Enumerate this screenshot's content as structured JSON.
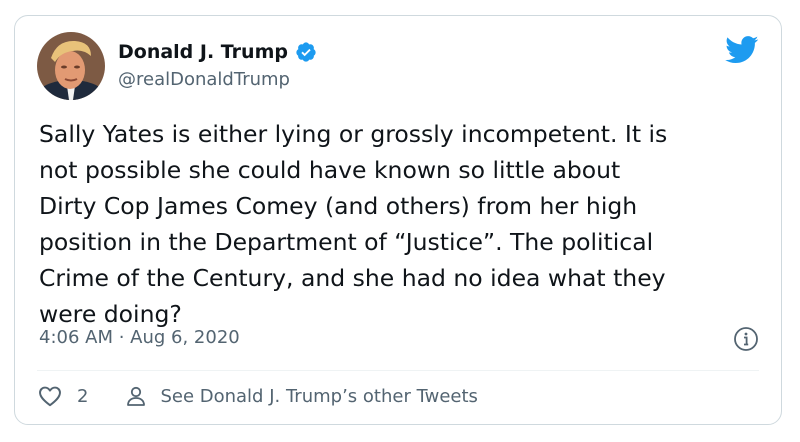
{
  "author": {
    "display_name": "Donald J. Trump",
    "handle": "@realDonaldTrump",
    "verified": true
  },
  "tweet": {
    "text": "Sally Yates is either lying or grossly incompetent. It is\nnot possible she could have known so little about\nDirty Cop James Comey (and others) from her high\nposition in the Department of “Justice”. The political\nCrime of the Century, and she had no idea what they\nwere doing?",
    "timestamp": "4:06 AM · Aug 6, 2020"
  },
  "actions": {
    "like_count": "2",
    "other_tweets_label": "See Donald J. Trump’s other Tweets"
  },
  "icons": {
    "avatar": "avatar-photo",
    "verified": "verified-badge-icon",
    "brand": "twitter-bird-icon",
    "info": "info-icon",
    "like": "heart-icon",
    "profile": "person-icon"
  },
  "colors": {
    "brand_blue": "#1d9bf0",
    "text_primary": "#0f1419",
    "text_secondary": "#536471",
    "border": "#cfd9de"
  }
}
